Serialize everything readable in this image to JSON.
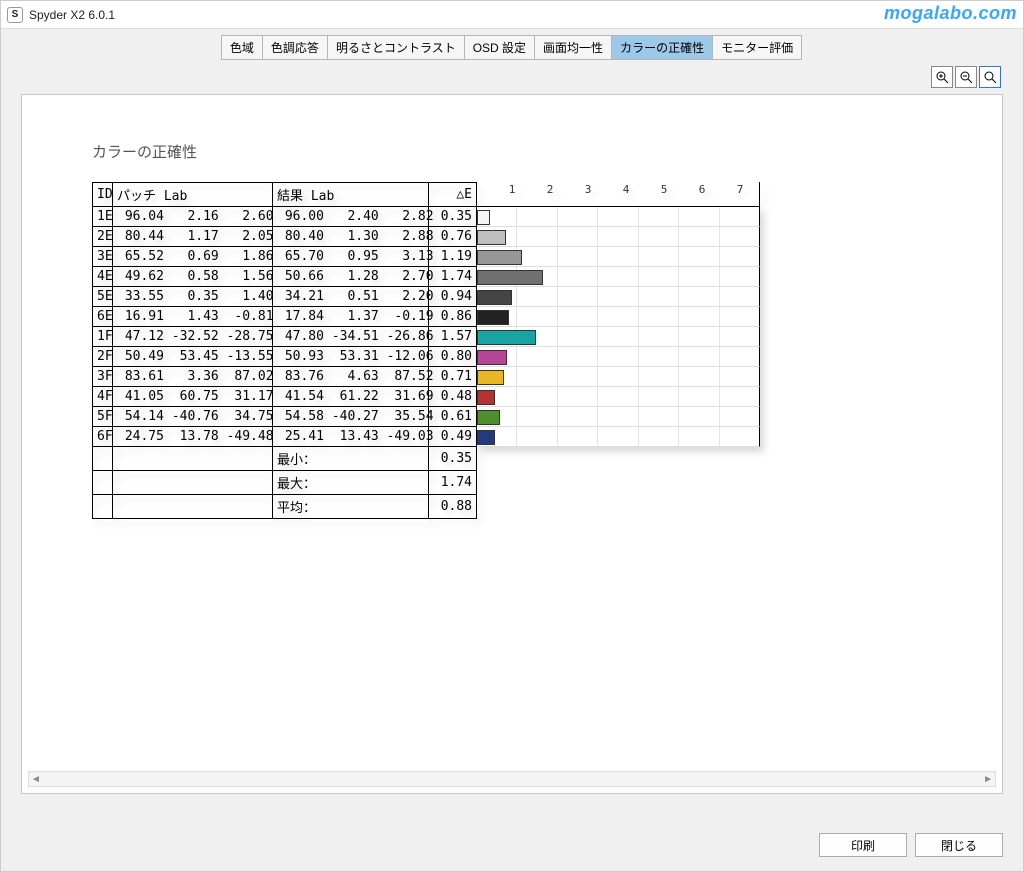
{
  "window": {
    "title": "Spyder X2 6.0.1",
    "title_icon": "S"
  },
  "watermark": "mogalabo.com",
  "tabs": [
    "色域",
    "色調応答",
    "明るさとコントラスト",
    "OSD 設定",
    "画面均一性",
    "カラーの正確性",
    "モニター評価"
  ],
  "active_tab_index": 5,
  "section_title": "カラーの正確性",
  "headers": {
    "id": "ID",
    "patch": "パッチ Lab",
    "result": "結果 Lab",
    "de": "△E"
  },
  "summary_labels": {
    "min": "最小：",
    "max": "最大：",
    "avg": "平均："
  },
  "summary": {
    "min": "0.35",
    "max": "1.74",
    "avg": "0.88"
  },
  "buttons": {
    "print": "印刷",
    "close": "閉じる"
  },
  "chart_data": {
    "type": "bar",
    "title": "△E",
    "xlabel": "",
    "ylabel": "△E",
    "xlim": [
      0,
      7.5
    ],
    "ticks": [
      1,
      2,
      3,
      4,
      5,
      6,
      7
    ],
    "categories": [
      "1E",
      "2E",
      "3E",
      "4E",
      "5E",
      "6E",
      "1F",
      "2F",
      "3F",
      "4F",
      "5F",
      "6F"
    ],
    "values": [
      0.35,
      0.76,
      1.19,
      1.74,
      0.94,
      0.86,
      1.57,
      0.8,
      0.71,
      0.48,
      0.61,
      0.49
    ],
    "colors": [
      "#f4f4f4",
      "#bfbfbf",
      "#979797",
      "#707070",
      "#454545",
      "#222222",
      "#1aa3a3",
      "#b54796",
      "#e8b728",
      "#b53232",
      "#4f8f2f",
      "#233a7d"
    ]
  },
  "rows": [
    {
      "id": "1E",
      "p1": "96.04",
      "p2": "2.16",
      "p3": "2.60",
      "r1": "96.00",
      "r2": "2.40",
      "r3": "2.82",
      "de": "0.35"
    },
    {
      "id": "2E",
      "p1": "80.44",
      "p2": "1.17",
      "p3": "2.05",
      "r1": "80.40",
      "r2": "1.30",
      "r3": "2.88",
      "de": "0.76"
    },
    {
      "id": "3E",
      "p1": "65.52",
      "p2": "0.69",
      "p3": "1.86",
      "r1": "65.70",
      "r2": "0.95",
      "r3": "3.13",
      "de": "1.19"
    },
    {
      "id": "4E",
      "p1": "49.62",
      "p2": "0.58",
      "p3": "1.56",
      "r1": "50.66",
      "r2": "1.28",
      "r3": "2.70",
      "de": "1.74"
    },
    {
      "id": "5E",
      "p1": "33.55",
      "p2": "0.35",
      "p3": "1.40",
      "r1": "34.21",
      "r2": "0.51",
      "r3": "2.20",
      "de": "0.94"
    },
    {
      "id": "6E",
      "p1": "16.91",
      "p2": "1.43",
      "p3": "-0.81",
      "r1": "17.84",
      "r2": "1.37",
      "r3": "-0.19",
      "de": "0.86"
    },
    {
      "id": "1F",
      "p1": "47.12",
      "p2": "-32.52",
      "p3": "-28.75",
      "r1": "47.80",
      "r2": "-34.51",
      "r3": "-26.86",
      "de": "1.57"
    },
    {
      "id": "2F",
      "p1": "50.49",
      "p2": "53.45",
      "p3": "-13.55",
      "r1": "50.93",
      "r2": "53.31",
      "r3": "-12.06",
      "de": "0.80"
    },
    {
      "id": "3F",
      "p1": "83.61",
      "p2": "3.36",
      "p3": "87.02",
      "r1": "83.76",
      "r2": "4.63",
      "r3": "87.52",
      "de": "0.71"
    },
    {
      "id": "4F",
      "p1": "41.05",
      "p2": "60.75",
      "p3": "31.17",
      "r1": "41.54",
      "r2": "61.22",
      "r3": "31.69",
      "de": "0.48"
    },
    {
      "id": "5F",
      "p1": "54.14",
      "p2": "-40.76",
      "p3": "34.75",
      "r1": "54.58",
      "r2": "-40.27",
      "r3": "35.54",
      "de": "0.61"
    },
    {
      "id": "6F",
      "p1": "24.75",
      "p2": "13.78",
      "p3": "-49.48",
      "r1": "25.41",
      "r2": "13.43",
      "r3": "-49.03",
      "de": "0.49"
    }
  ]
}
